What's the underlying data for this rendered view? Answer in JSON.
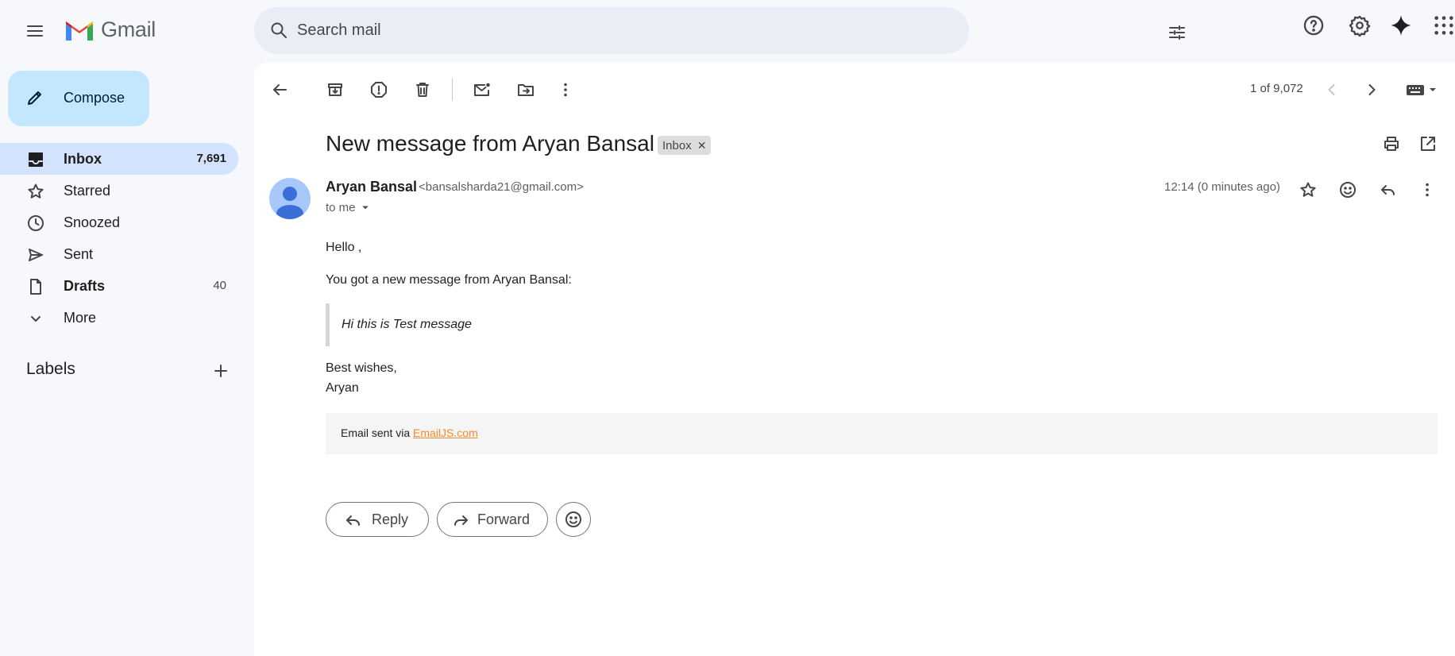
{
  "app": {
    "name": "Gmail"
  },
  "search": {
    "placeholder": "Search mail"
  },
  "sidebar": {
    "compose_label": "Compose",
    "items": [
      {
        "label": "Inbox",
        "count": "7,691"
      },
      {
        "label": "Starred",
        "count": ""
      },
      {
        "label": "Snoozed",
        "count": ""
      },
      {
        "label": "Sent",
        "count": ""
      },
      {
        "label": "Drafts",
        "count": "40"
      },
      {
        "label": "More",
        "count": ""
      }
    ],
    "labels_heading": "Labels"
  },
  "toolbar": {
    "pager": "1 of 9,072"
  },
  "message": {
    "subject": "New message from Aryan Bansal",
    "label_chip": "Inbox",
    "sender_name": "Aryan Bansal",
    "sender_email": "<bansalsharda21@gmail.com>",
    "recipient": "to me",
    "timestamp": "12:14 (0 minutes ago)",
    "body": {
      "greeting": "Hello ,",
      "intro": "You got a new message from Aryan Bansal:",
      "quote": "Hi this is Test message",
      "signoff_line1": "Best wishes,",
      "signoff_line2": "Aryan",
      "footer_prefix": "Email sent via ",
      "footer_link": "EmailJS.com"
    }
  },
  "actions": {
    "reply_label": "Reply",
    "forward_label": "Forward"
  },
  "colors": {
    "background": "#f6f8fc",
    "search_bg": "#e9eef6",
    "compose_bg": "#c2e7ff",
    "active_nav_bg": "#d3e3fd",
    "link_color": "#f08c28"
  }
}
